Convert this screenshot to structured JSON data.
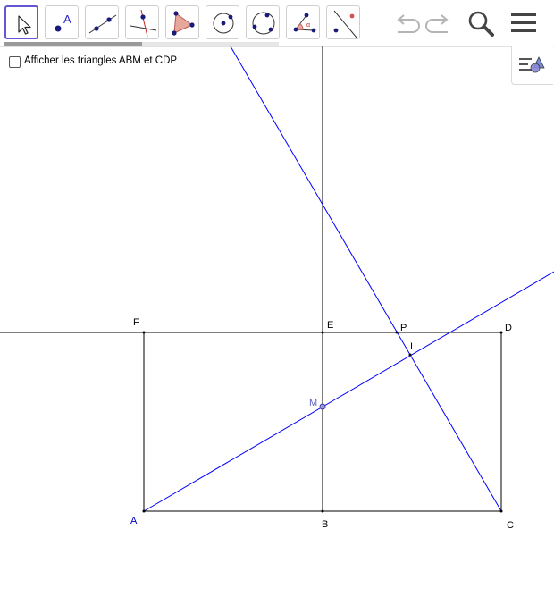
{
  "toolbar": {
    "tools": [
      {
        "name": "move-tool",
        "selected": true
      },
      {
        "name": "point-tool",
        "glyph": "A"
      },
      {
        "name": "line-tool"
      },
      {
        "name": "perpendicular-line-tool"
      },
      {
        "name": "polygon-tool"
      },
      {
        "name": "circle-center-point-tool"
      },
      {
        "name": "circle-three-points-tool"
      },
      {
        "name": "angle-tool"
      },
      {
        "name": "reflect-tool"
      }
    ],
    "right_icons": [
      "undo-icon",
      "redo-icon",
      "search-icon",
      "menu-icon"
    ],
    "progress": 0.5
  },
  "options": {
    "checkbox_label": "Afficher les triangles ABM et CDP",
    "checked": false
  },
  "graphics": {
    "points": {
      "A": "A",
      "B": "B",
      "C": "C",
      "D": "D",
      "E": "E",
      "F": "F",
      "P": "P",
      "I": "I",
      "M": "M"
    },
    "colors": {
      "line_black": "#000000",
      "line_blue": "#0000ff",
      "point_m": "#5f5fc9",
      "selected_tool": "#6557d2"
    }
  }
}
